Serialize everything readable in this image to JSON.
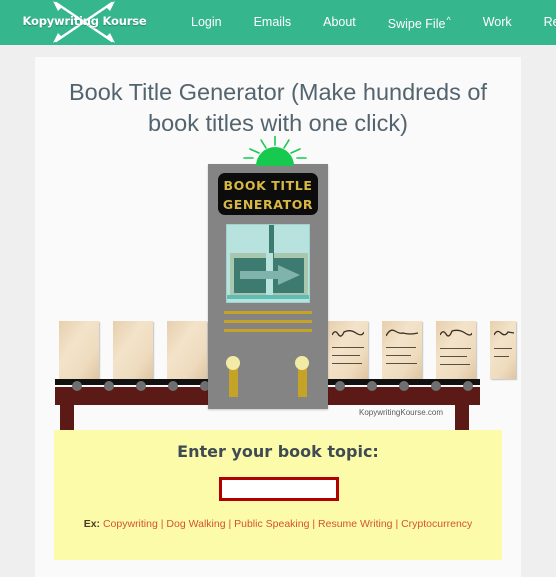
{
  "header": {
    "brand": "Kopywriting Kourse",
    "brand_icon": "crossed-pens-logo",
    "background_color": "#36b68c",
    "nav": [
      {
        "label": "Login",
        "caret": ""
      },
      {
        "label": "Emails",
        "caret": ""
      },
      {
        "label": "About",
        "caret": ""
      },
      {
        "label": "Swipe File",
        "caret": "^"
      },
      {
        "label": "Work",
        "caret": ""
      },
      {
        "label": "Resources",
        "caret": ""
      }
    ]
  },
  "main": {
    "page_title": "Book Title Generator (Make hundreds of book titles with one click)",
    "illustration": {
      "machine_sign_line1": "BOOK TITLE",
      "machine_sign_line2": "GENERATOR",
      "sign_text_color": "#d8b844",
      "dome_light_color": "#17c94f",
      "machine_body_color": "#848484",
      "conveyor_color": "#5c1a17",
      "arrow_direction": "right",
      "blank_papers_count": 4,
      "printed_papers_count": 4,
      "watermark": "KopywritingKourse.com"
    },
    "form": {
      "heading": "Enter your book topic:",
      "input_value": "",
      "input_placeholder": "",
      "input_border_color": "#b00000",
      "box_color": "#fcfbaa",
      "examples_label": "Ex:",
      "examples": [
        "Copywriting",
        "Dog Walking",
        "Public Speaking",
        "Resume Writing",
        "Cryptocurrency"
      ],
      "example_separator": "|"
    }
  }
}
